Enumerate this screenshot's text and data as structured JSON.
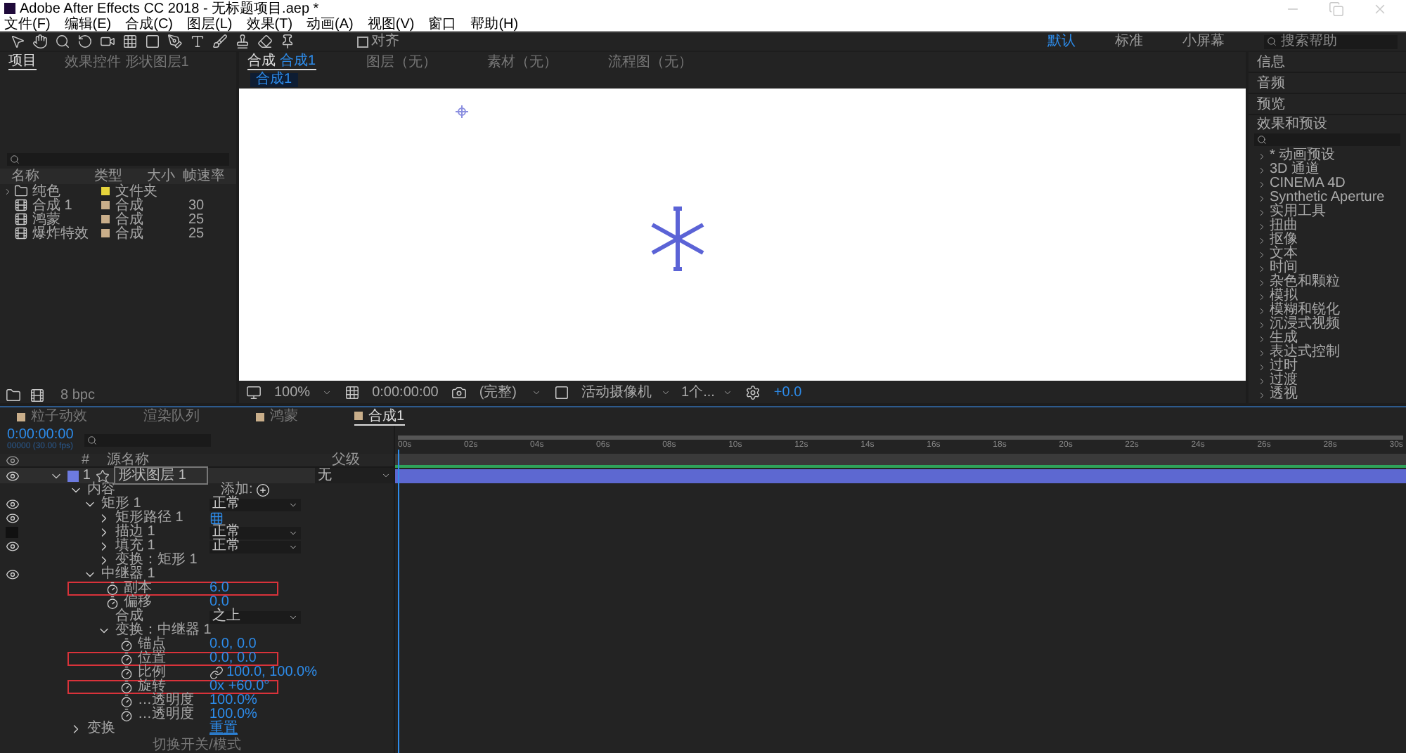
{
  "window": {
    "title": "Adobe After Effects CC 2018 - 无标题项目.aep *"
  },
  "menu": [
    "文件(F)",
    "编辑(E)",
    "合成(C)",
    "图层(L)",
    "效果(T)",
    "动画(A)",
    "视图(V)",
    "窗口",
    "帮助(H)"
  ],
  "toolbar": {
    "snap": {
      "label": "对齐",
      "checked": false
    },
    "workspaces": [
      {
        "label": "默认",
        "selected": true
      },
      {
        "label": "标准",
        "selected": false
      },
      {
        "label": "小屏幕",
        "selected": false
      }
    ],
    "search": {
      "placeholder": "搜索帮助"
    }
  },
  "project": {
    "tabs": [
      {
        "label": "项目",
        "selected": true
      },
      {
        "label": "效果控件 形状图层1",
        "selected": false
      }
    ],
    "columns": [
      "名称",
      "类型",
      "大小",
      "帧速率"
    ],
    "items": [
      {
        "name": "纯色",
        "kind": "folder",
        "color": "#e6d43c",
        "type": "文件夹"
      },
      {
        "name": "合成 1",
        "kind": "comp",
        "color": "#c9ae8a",
        "type": "合成",
        "rate": "30"
      },
      {
        "name": "鸿蒙",
        "kind": "comp",
        "color": "#c9ae8a",
        "type": "合成",
        "rate": "25"
      },
      {
        "name": "爆炸特效",
        "kind": "comp",
        "color": "#c9ae8a",
        "type": "合成",
        "rate": "25"
      }
    ],
    "bit_depth": "8 bpc"
  },
  "viewer": {
    "tabs": [
      {
        "prefix": "合成",
        "label": "合成1",
        "selected": true
      },
      {
        "label": "图层（无）",
        "selected": false
      },
      {
        "label": "素材（无）",
        "selected": false
      },
      {
        "label": "流程图（无）",
        "selected": false
      }
    ],
    "breadcrumb": "合成1",
    "footer": {
      "zoom": "100%",
      "timecode": "0:00:00:00",
      "resolution": "(完整)",
      "camera": "活动摄像机",
      "views": "1个...",
      "exposure": "+0.0"
    }
  },
  "right_panel": {
    "sections": [
      "信息",
      "音频",
      "预览"
    ],
    "effects_title": "效果和预设",
    "categories": [
      "* 动画预设",
      "3D 通道",
      "CINEMA 4D",
      "Synthetic Aperture",
      "实用工具",
      "扭曲",
      "抠像",
      "文本",
      "时间",
      "杂色和颗粒",
      "模拟",
      "模糊和锐化",
      "沉浸式视频",
      "生成",
      "表达式控制",
      "过时",
      "过渡",
      "透视"
    ]
  },
  "timeline": {
    "tabs": [
      {
        "label": "粒子动效",
        "color": "#c9ae8a",
        "selected": false
      },
      {
        "label": "渲染队列",
        "selected": false
      },
      {
        "label": "鸿蒙",
        "color": "#c9ae8a",
        "selected": false
      },
      {
        "label": "合成1",
        "color": "#c9ae8a",
        "selected": true
      }
    ],
    "timecode": "0:00:00:00",
    "frame_info": "00000 (30.00 fps)",
    "columns": [
      "#",
      "源名称",
      "父级"
    ],
    "layer": {
      "number": "1",
      "name": "形状图层 1",
      "color": "#6d7be0",
      "parent": "无",
      "expanded": true,
      "visible": true
    },
    "properties": [
      {
        "label": "内容",
        "kind": "group",
        "expanded": true,
        "add_label": "添加:",
        "children": [
          {
            "label": "矩形 1",
            "kind": "group",
            "expanded": true,
            "visible": true,
            "value": "正常",
            "children": [
              {
                "label": "矩形路径 1",
                "kind": "path_group",
                "expanded": false,
                "visible": true
              },
              {
                "label": "描边 1",
                "kind": "group",
                "expanded": false,
                "visible": false,
                "value": "正常"
              },
              {
                "label": "填充 1",
                "kind": "group",
                "expanded": false,
                "visible": true,
                "value": "正常"
              },
              {
                "label": "变换：矩形 1",
                "kind": "group",
                "expanded": false
              }
            ]
          },
          {
            "label": "中继器 1",
            "kind": "group",
            "expanded": true,
            "visible": true,
            "children": [
              {
                "label": "副本",
                "kind": "prop",
                "value": "6.0",
                "highlighted": true
              },
              {
                "label": "偏移",
                "kind": "prop",
                "value": "0.0",
                "highlighted": false
              },
              {
                "label": "合成",
                "kind": "select",
                "value": "之上"
              },
              {
                "label": "变换：中继器 1",
                "kind": "group",
                "expanded": true,
                "children": [
                  {
                    "label": "锚点",
                    "kind": "prop",
                    "value": "0.0, 0.0",
                    "highlighted": false
                  },
                  {
                    "label": "位置",
                    "kind": "prop",
                    "value": "0.0, 0.0",
                    "highlighted": true
                  },
                  {
                    "label": "比例",
                    "kind": "linked_prop",
                    "value": "100.0, 100.0%",
                    "highlighted": false
                  },
                  {
                    "label": "旋转",
                    "kind": "prop",
                    "value": "0x +60.0°",
                    "highlighted": true
                  },
                  {
                    "label": "…透明度",
                    "kind": "prop",
                    "value": "100.0%",
                    "highlighted": false
                  },
                  {
                    "label": "…透明度",
                    "kind": "prop",
                    "value": "100.0%",
                    "highlighted": false
                  }
                ]
              }
            ]
          }
        ]
      },
      {
        "label": "变换",
        "kind": "group",
        "expanded": false,
        "reset_label": "重置"
      }
    ],
    "ruler": [
      "00s",
      "02s",
      "04s",
      "06s",
      "08s",
      "10s",
      "12s",
      "14s",
      "16s",
      "18s",
      "20s",
      "22s",
      "24s",
      "26s",
      "28s",
      "30s"
    ],
    "status": "切换开关/模式"
  }
}
